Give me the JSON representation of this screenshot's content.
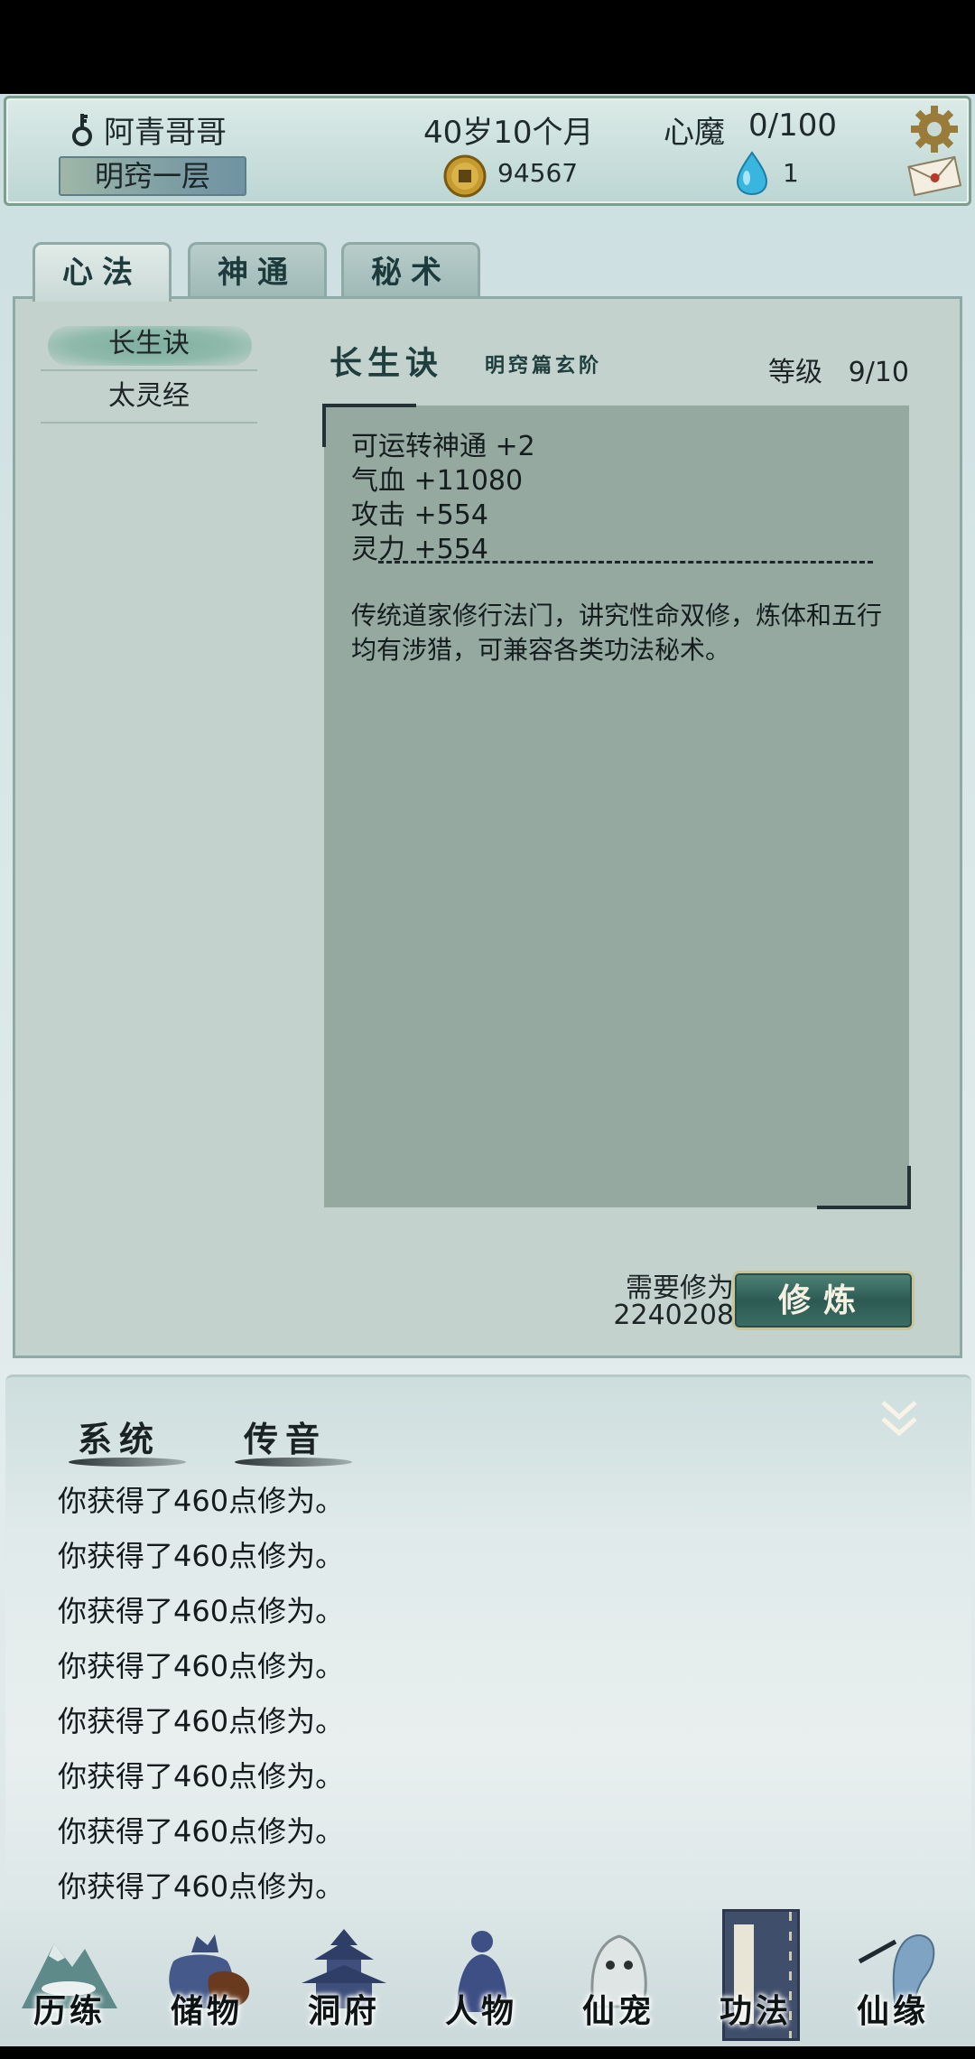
{
  "header": {
    "player_name": "阿青哥哥",
    "age": "40岁10个月",
    "heart_demon_label": "心魔",
    "heart_demon_value": "0/100",
    "realm": "明窍一层",
    "coins": "94567",
    "gems": "1",
    "icons": {
      "key": "key-icon",
      "coin": "coin-icon",
      "gem": "gem-icon",
      "settings": "gear-icon",
      "mail": "mail-icon"
    }
  },
  "tabs": [
    {
      "label": "心法",
      "active": true
    },
    {
      "label": "神通",
      "active": false
    },
    {
      "label": "秘术",
      "active": false
    }
  ],
  "technique_list": [
    {
      "label": "长生诀",
      "selected": true
    },
    {
      "label": "太灵经",
      "selected": false
    }
  ],
  "detail": {
    "name": "长生诀",
    "category": "明窍篇玄阶",
    "level_label": "等级",
    "level_value": "9/10",
    "stats": [
      "可运转神通 +2",
      "气血 +11080",
      "攻击 +554",
      "灵力 +554"
    ],
    "description": "传统道家修行法门，讲究性命双修，炼体和五行均有涉猎，可兼容各类功法秘术。",
    "cost_label": "需要修为",
    "cost_value": "2240208",
    "action_label": "修炼"
  },
  "messages": {
    "tabs": [
      "系统",
      "传音"
    ],
    "lines": [
      "你获得了460点修为。",
      "你获得了460点修为。",
      "你获得了460点修为。",
      "你获得了460点修为。",
      "你获得了460点修为。",
      "你获得了460点修为。",
      "你获得了460点修为。",
      "你获得了460点修为。"
    ]
  },
  "bottom_nav": [
    {
      "label": "历练",
      "icon": "mountain-icon"
    },
    {
      "label": "储物",
      "icon": "bag-icon"
    },
    {
      "label": "洞府",
      "icon": "pagoda-icon"
    },
    {
      "label": "人物",
      "icon": "person-icon"
    },
    {
      "label": "仙宠",
      "icon": "pet-icon"
    },
    {
      "label": "功法",
      "icon": "book-icon",
      "active": true
    },
    {
      "label": "仙缘",
      "icon": "crane-icon"
    }
  ],
  "colors": {
    "accent": "#2c5a52",
    "panel": "#c3d2cd",
    "desc_box": "#95a9a0",
    "nav_active": "#3f4e6a"
  }
}
